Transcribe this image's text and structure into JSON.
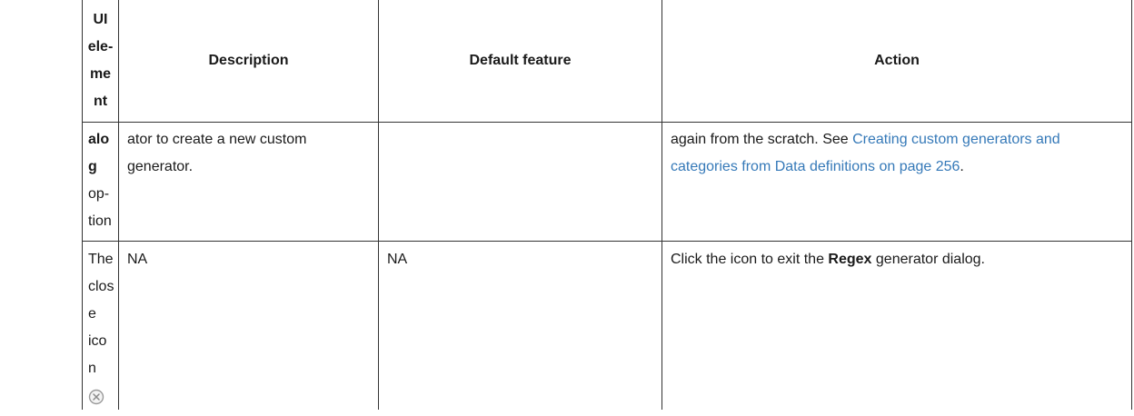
{
  "table": {
    "headers": {
      "ui_element": [
        "UI",
        "ele-",
        "ment"
      ],
      "description": "Description",
      "default_feature": "Default feature",
      "action": "Action"
    },
    "rows": [
      {
        "ui_element": {
          "bold": "alog",
          "rest": [
            "op-",
            "tion"
          ]
        },
        "description": "ator to create a new custom generator.",
        "default_feature": "",
        "action": {
          "prefix": "again from the scratch. See ",
          "link": "Creating custom generators and categories from Data definitions on page 256",
          "suffix": "."
        }
      },
      {
        "ui_element": {
          "lines": [
            "The",
            "close",
            "icon"
          ],
          "icon": "close-circle-icon"
        },
        "description": "NA",
        "default_feature": "NA",
        "action": {
          "prefix": "Click the icon to exit the ",
          "bold": "Regex",
          "suffix": " generator dialog."
        }
      }
    ]
  },
  "colors": {
    "link": "#3579b8",
    "border": "#333333",
    "icon_gray": "#9a9a9a"
  }
}
